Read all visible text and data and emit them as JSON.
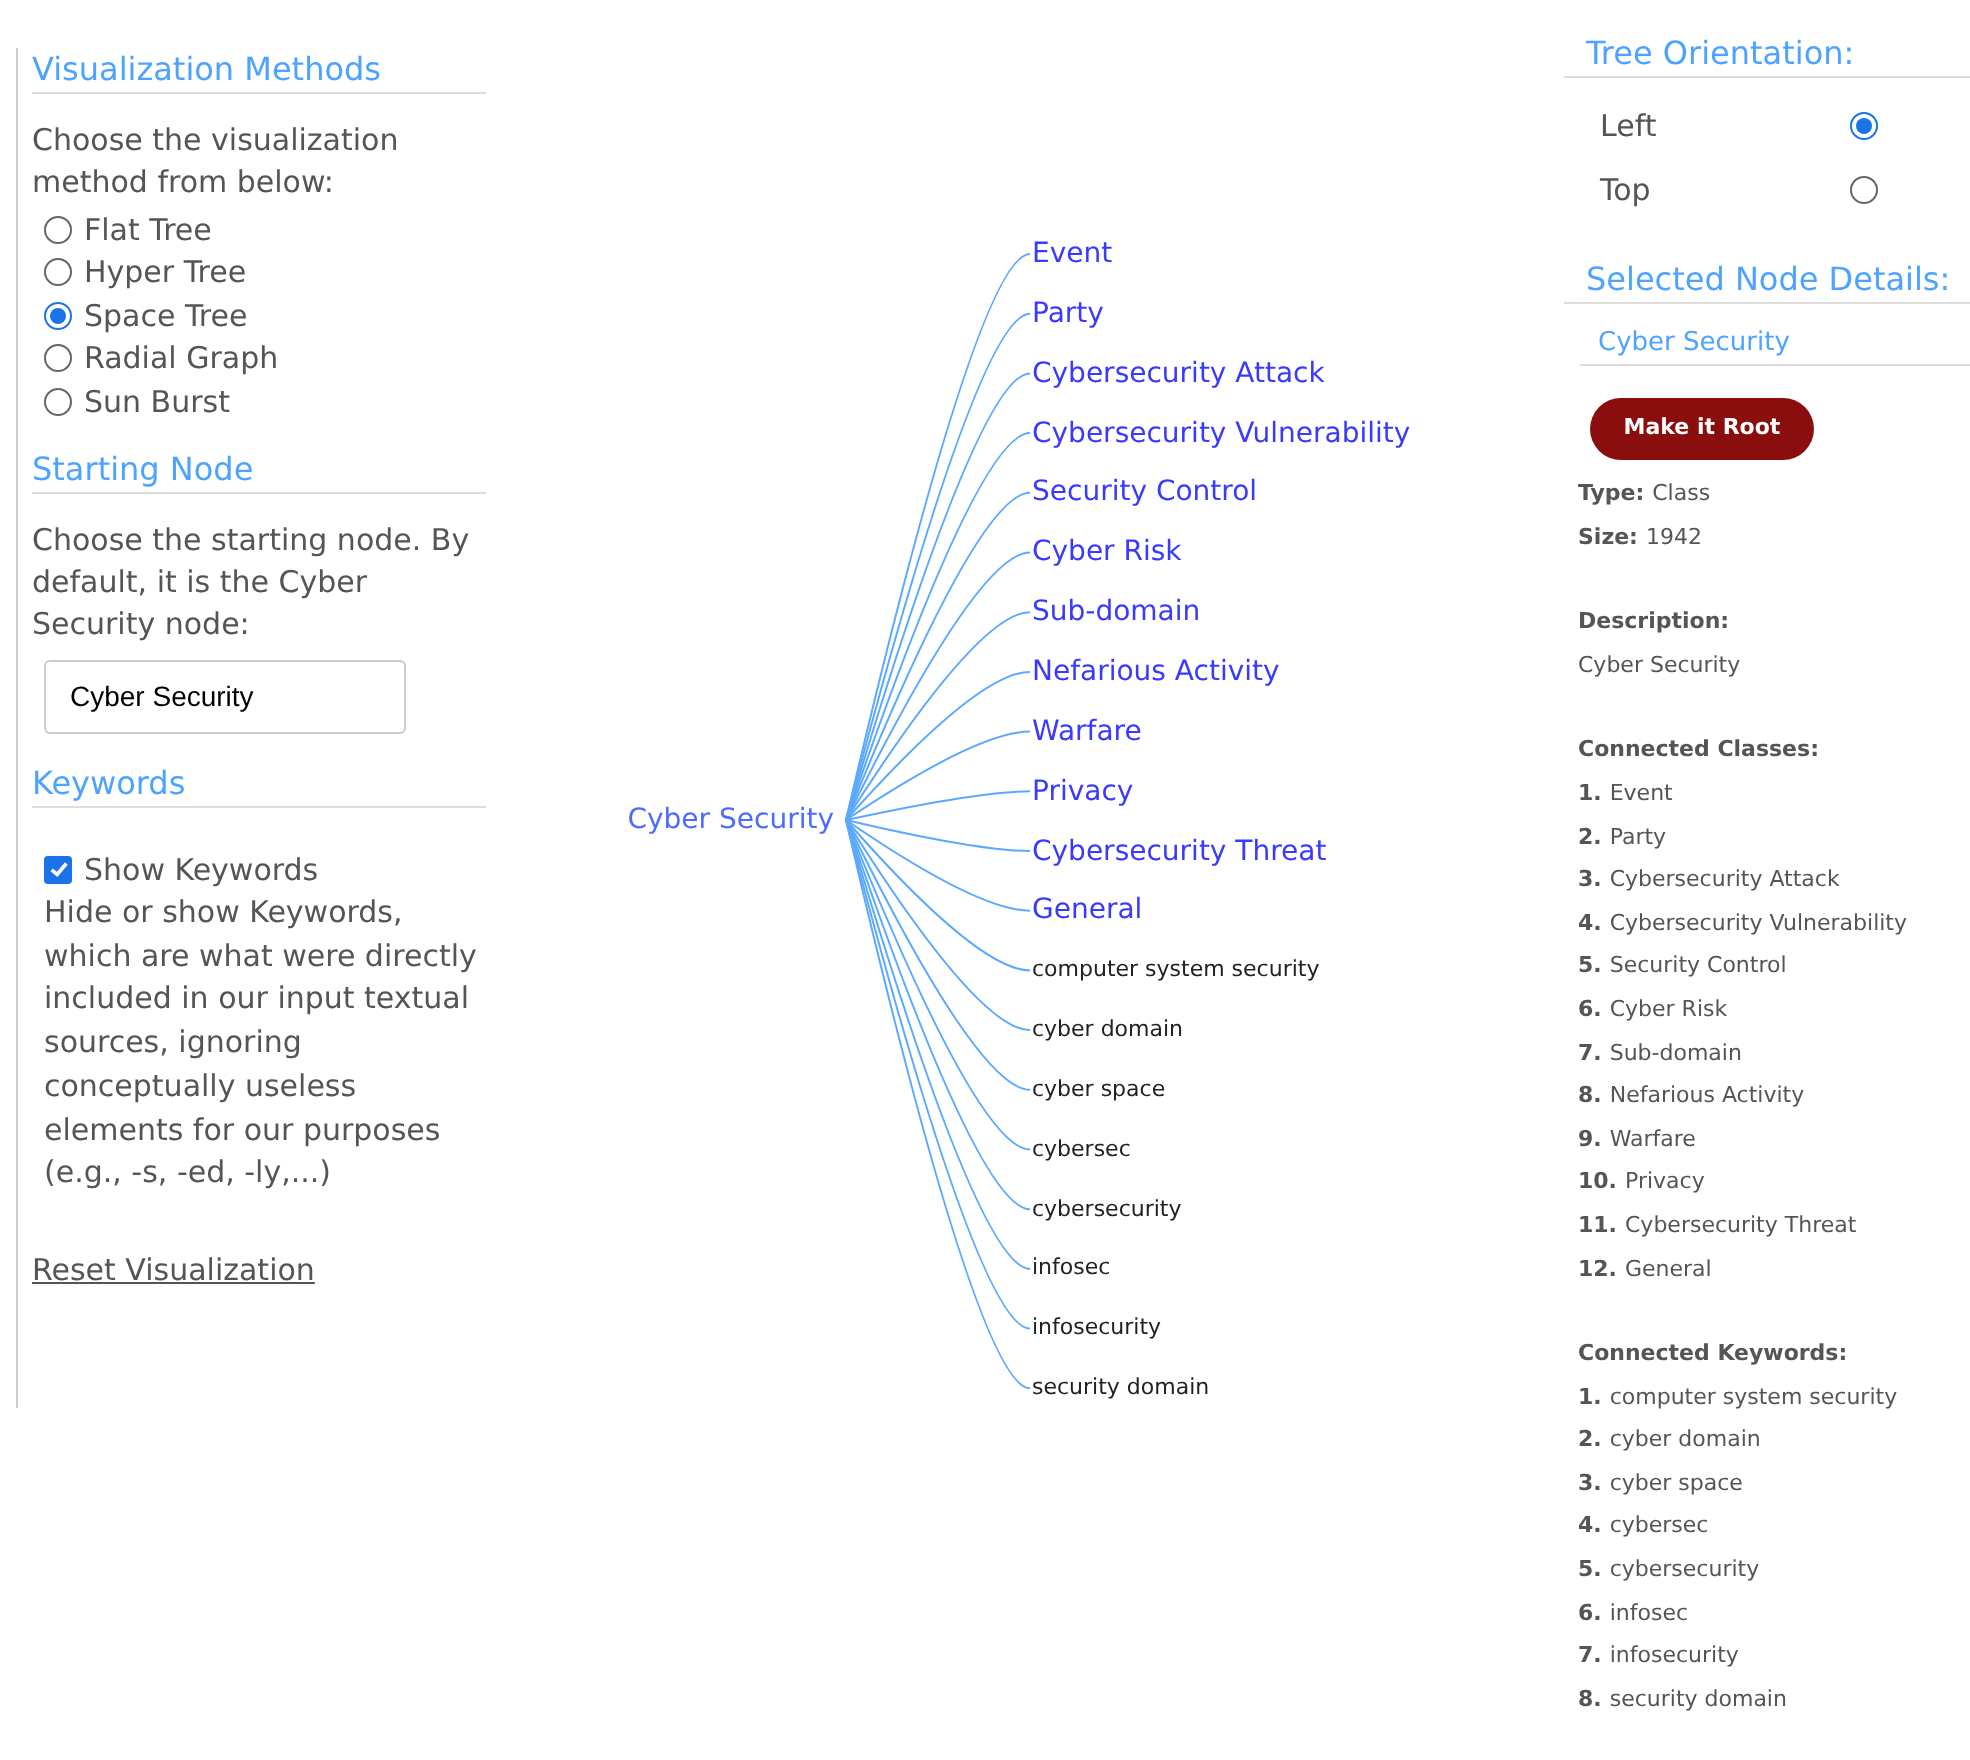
{
  "left_panel": {
    "visualization": {
      "heading": "Visualization Methods",
      "intro": "Choose the visualization method from below:",
      "options": [
        {
          "label": "Flat Tree",
          "selected": false
        },
        {
          "label": "Hyper Tree",
          "selected": false
        },
        {
          "label": "Space Tree",
          "selected": true
        },
        {
          "label": "Radial Graph",
          "selected": false
        },
        {
          "label": "Sun Burst",
          "selected": false
        }
      ]
    },
    "starting_node": {
      "heading": "Starting Node",
      "intro": "Choose the starting node. By default, it is the Cyber Security node:",
      "value": "Cyber Security"
    },
    "keywords": {
      "heading": "Keywords",
      "checkbox": {
        "label": "Show Keywords",
        "checked": true
      },
      "help": "Hide or show Keywords, which are what were directly included in our input textual sources, ignoring conceptually useless elements for our purposes (e.g., -s, -ed, -ly,...)"
    },
    "reset_link": "Reset Visualization"
  },
  "tree": {
    "root": "Cyber Security",
    "children": [
      {
        "label": "Event",
        "kind": "class"
      },
      {
        "label": "Party",
        "kind": "class"
      },
      {
        "label": "Cybersecurity Attack",
        "kind": "class"
      },
      {
        "label": "Cybersecurity Vulnerability",
        "kind": "class"
      },
      {
        "label": "Security Control",
        "kind": "class"
      },
      {
        "label": "Cyber Risk",
        "kind": "class"
      },
      {
        "label": "Sub-domain",
        "kind": "class"
      },
      {
        "label": "Nefarious Activity",
        "kind": "class"
      },
      {
        "label": "Warfare",
        "kind": "class"
      },
      {
        "label": "Privacy",
        "kind": "class"
      },
      {
        "label": "Cybersecurity Threat",
        "kind": "class"
      },
      {
        "label": "General",
        "kind": "class"
      },
      {
        "label": "computer system security",
        "kind": "keyword"
      },
      {
        "label": "cyber domain",
        "kind": "keyword"
      },
      {
        "label": "cyber space",
        "kind": "keyword"
      },
      {
        "label": "cybersec",
        "kind": "keyword"
      },
      {
        "label": "cybersecurity",
        "kind": "keyword"
      },
      {
        "label": "infosec",
        "kind": "keyword"
      },
      {
        "label": "infosecurity",
        "kind": "keyword"
      },
      {
        "label": "security domain",
        "kind": "keyword"
      }
    ]
  },
  "right_panel": {
    "orientation": {
      "heading": "Tree Orientation:",
      "options": [
        {
          "label": "Left",
          "selected": true
        },
        {
          "label": "Top",
          "selected": false
        }
      ]
    },
    "details": {
      "heading": "Selected Node Details:",
      "node_name": "Cyber Security",
      "button": "Make it Root",
      "fields": [
        {
          "label": "Type:",
          "value": "Class"
        },
        {
          "label": "Size:",
          "value": "1942"
        }
      ],
      "description_label": "Description:",
      "description": "Cyber Security",
      "classes_label": "Connected Classes:",
      "classes": [
        {
          "number": "1.",
          "label": "Event"
        },
        {
          "number": "2.",
          "label": "Party"
        },
        {
          "number": "3.",
          "label": "Cybersecurity Attack"
        },
        {
          "number": "4.",
          "label": "Cybersecurity Vulnerability"
        },
        {
          "number": "5.",
          "label": "Security Control"
        },
        {
          "number": "6.",
          "label": "Cyber Risk"
        },
        {
          "number": "7.",
          "label": "Sub-domain"
        },
        {
          "number": "8.",
          "label": "Nefarious Activity"
        },
        {
          "number": "9.",
          "label": "Warfare"
        },
        {
          "number": "10.",
          "label": "Privacy"
        },
        {
          "number": "11.",
          "label": "Cybersecurity Threat"
        },
        {
          "number": "12.",
          "label": "General"
        }
      ],
      "keywords_label": "Connected Keywords:",
      "keywords": [
        {
          "number": "1.",
          "label": "computer system security"
        },
        {
          "number": "2.",
          "label": "cyber domain"
        },
        {
          "number": "3.",
          "label": "cyber space"
        },
        {
          "number": "4.",
          "label": "cybersec"
        },
        {
          "number": "5.",
          "label": "cybersecurity"
        },
        {
          "number": "6.",
          "label": "infosec"
        },
        {
          "number": "7.",
          "label": "infosecurity"
        },
        {
          "number": "8.",
          "label": "security domain"
        }
      ]
    }
  }
}
